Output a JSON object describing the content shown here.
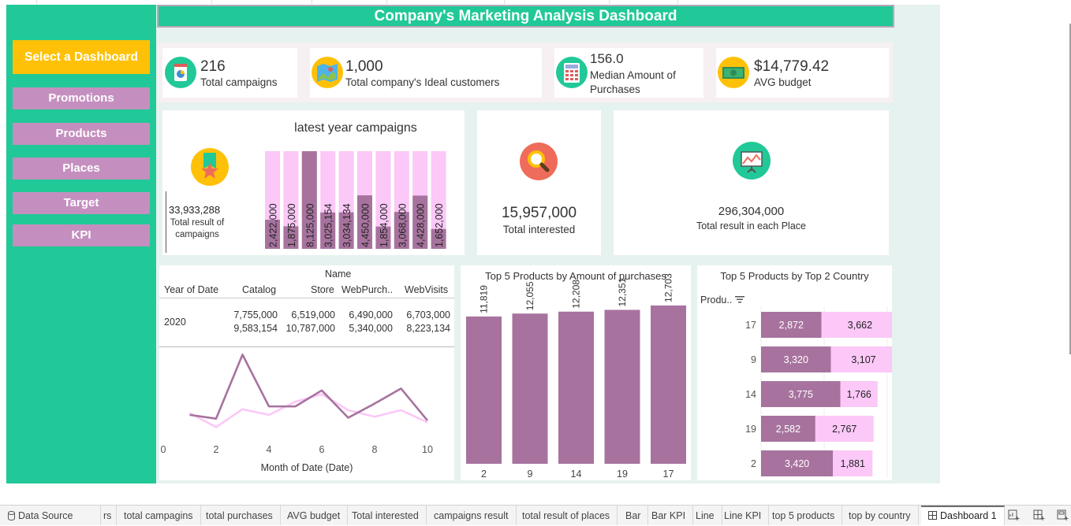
{
  "dashboard": {
    "title": "Company's Marketing Analysis Dashboard",
    "colors": {
      "accent": "#20c997",
      "button": "#c48fbf",
      "selected": "#ffc107",
      "bar_dark": "#a7739e",
      "bar_light": "#fbc8f7"
    }
  },
  "sidebar": {
    "selected_label": "Select a Dashboard",
    "items": [
      {
        "label": "Promotions"
      },
      {
        "label": "Products"
      },
      {
        "label": "Places"
      },
      {
        "label": "Target"
      },
      {
        "label": "KPI"
      }
    ]
  },
  "kpis": [
    {
      "value": "216",
      "label": "Total campaigns",
      "icon": "pie-chart-icon"
    },
    {
      "value": "1,000",
      "label": "Total company's Ideal customers",
      "icon": "map-icon"
    },
    {
      "value": "156.0",
      "label": "Median Amount of Purchases",
      "icon": "calculator-icon"
    },
    {
      "value": "$14,779.42",
      "label": "AVG budget",
      "icon": "money-icon"
    }
  ],
  "campaigns_panel": {
    "title": "latest year campaigns",
    "total_value": "33,933,288",
    "total_label": "Total result of campaigns",
    "icon": "medal-icon"
  },
  "interested_panel": {
    "value": "15,957,000",
    "label": "Total interested",
    "icon": "magnifier-icon"
  },
  "places_panel": {
    "value": "296,304,000",
    "label": "Total result in each Place",
    "icon": "presentation-icon"
  },
  "table_panel": {
    "group_header": "Name",
    "columns": [
      "Year of Date",
      "Catalog",
      "Store",
      "WebPurch..",
      "WebVisits"
    ],
    "row_year": "2020",
    "rows": [
      [
        "7,755,000",
        "6,519,000",
        "6,490,000",
        "6,703,000"
      ],
      [
        "9,583,154",
        "10,787,000",
        "5,340,000",
        "8,223,134"
      ]
    ],
    "xlabel": "Month of Date (Date)"
  },
  "products_panel": {
    "title": "Top 5 Products by Amount of purchases"
  },
  "country_panel": {
    "title": "Top 5 Products by Top 2 Country",
    "axis_label": "Produ..",
    "sort_icon": "sort-icon"
  },
  "chart_data": [
    {
      "type": "bar",
      "title": "latest year campaigns",
      "values": [
        2422000,
        1875000,
        8125000,
        3025154,
        3034134,
        4450000,
        1854000,
        3068000,
        4428000,
        1652000
      ],
      "labels": [
        "2,422,000",
        "1,875,000",
        "8,125,000",
        "3,025,154",
        "3,034,134",
        "4,450,000",
        "1,854,000",
        "3,068,000",
        "4,428,000",
        "1,652,000"
      ],
      "ylim": [
        0,
        8125000
      ]
    },
    {
      "type": "line",
      "x": [
        1,
        2,
        3,
        4,
        5,
        6,
        7,
        8,
        9,
        10
      ],
      "xticks": [
        0,
        2,
        4,
        6,
        8,
        10
      ],
      "xlabel": "Month of Date (Date)",
      "series": [
        {
          "values": [
            9,
            5,
            73,
            18,
            18,
            35,
            6,
            21,
            37,
            3
          ]
        },
        {
          "values": [
            11,
            -4,
            15,
            9,
            23,
            31,
            14,
            7,
            14,
            1
          ]
        }
      ],
      "ylim": [
        -12,
        80
      ]
    },
    {
      "type": "bar",
      "title": "Top 5 Products by Amount of purchases",
      "categories": [
        "2",
        "9",
        "14",
        "19",
        "17"
      ],
      "values": [
        11819,
        12055,
        12208,
        12351,
        12703
      ],
      "labels": [
        "11,819",
        "12,055",
        "12,208",
        "12,351",
        "12,703"
      ],
      "ylim": [
        0,
        13900
      ]
    },
    {
      "type": "bar",
      "title": "Top 5 Products by Top 2 Country",
      "orientation": "horizontal",
      "stacked": true,
      "categories": [
        "17",
        "9",
        "14",
        "19",
        "2"
      ],
      "series": [
        {
          "values": [
            2872,
            3320,
            3775,
            2582,
            3420
          ],
          "labels": [
            "2,872",
            "3,320",
            "3,775",
            "2,582",
            "3,420"
          ]
        },
        {
          "values": [
            3662,
            3107,
            1766,
            2767,
            1881
          ],
          "labels": [
            "3,662",
            "3,107",
            "1,766",
            "2,767",
            "1,881"
          ]
        }
      ],
      "xlim": [
        0,
        6600
      ]
    }
  ],
  "tabs": [
    {
      "label": "Data Source",
      "icon": "database-icon"
    },
    {
      "label": "rs"
    },
    {
      "label": "total campagins"
    },
    {
      "label": "total purchases"
    },
    {
      "label": "AVG budget"
    },
    {
      "label": "Total interested"
    },
    {
      "label": "campaigns result"
    },
    {
      "label": "total result of places"
    },
    {
      "label": "Bar"
    },
    {
      "label": "Bar KPI"
    },
    {
      "label": "Line"
    },
    {
      "label": "Line KPI"
    },
    {
      "label": "top 5 products"
    },
    {
      "label": "top by country"
    },
    {
      "label": "Dashboard 1",
      "icon": "dashboard-icon"
    }
  ]
}
